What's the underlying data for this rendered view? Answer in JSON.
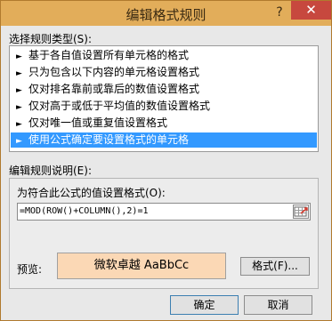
{
  "window": {
    "title": "编辑格式规则",
    "help": "?",
    "close": "✕"
  },
  "rule_type": {
    "label": "选择规则类型(S):",
    "items": [
      {
        "label": "基于各自值设置所有单元格的格式",
        "selected": false
      },
      {
        "label": "只为包含以下内容的单元格设置格式",
        "selected": false
      },
      {
        "label": "仅对排名靠前或靠后的数值设置格式",
        "selected": false
      },
      {
        "label": "仅对高于或低于平均值的数值设置格式",
        "selected": false
      },
      {
        "label": "仅对唯一值或重复值设置格式",
        "selected": false
      },
      {
        "label": "使用公式确定要设置格式的单元格",
        "selected": true
      }
    ],
    "arrow_icon": "►"
  },
  "rule_desc": {
    "label": "编辑规则说明(E):",
    "formula_label": "为符合此公式的值设置格式(O):",
    "formula_value": "=MOD(ROW()+COLUMN(),2)=1",
    "preview_label": "预览:",
    "preview_text": "微软卓越  AaBbCc",
    "preview_color": "#fbd8b5",
    "format_button": "格式(F)..."
  },
  "footer": {
    "ok": "确定",
    "cancel": "取消"
  },
  "colors": {
    "titlebar": "#e2ad5a",
    "close": "#c7483e",
    "selection": "#3399ff"
  }
}
